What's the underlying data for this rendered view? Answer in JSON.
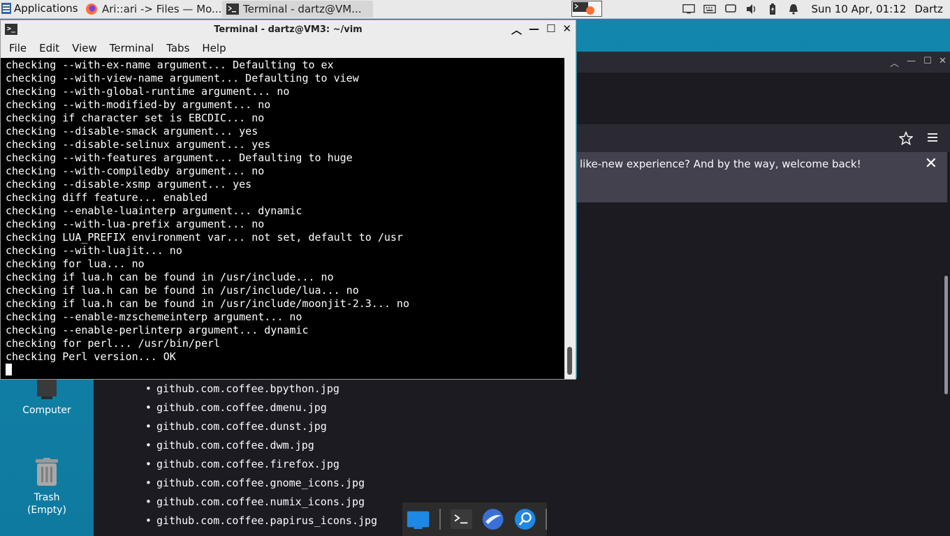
{
  "panel": {
    "apps_label": "Applications",
    "tasks": [
      {
        "label": "Ari::ari -> Files — Mo..."
      },
      {
        "label": "Terminal - dartz@VM..."
      }
    ],
    "clock": "Sun 10 Apr, 01:12",
    "user": "Dartz"
  },
  "desktop": {
    "icons": [
      {
        "label": "Computer"
      },
      {
        "label": "Trash\n(Empty)"
      }
    ]
  },
  "firefox": {
    "notice": "like-new experience? And by the way, welcome back!",
    "files": [
      "github.com.coffee.bpython.jpg",
      "github.com.coffee.dmenu.jpg",
      "github.com.coffee.dunst.jpg",
      "github.com.coffee.dwm.jpg",
      "github.com.coffee.firefox.jpg",
      "github.com.coffee.gnome_icons.jpg",
      "github.com.coffee.numix_icons.jpg",
      "github.com.coffee.papirus_icons.jpg"
    ]
  },
  "terminal": {
    "title": "Terminal - dartz@VM3: ~/vim",
    "menu": [
      "File",
      "Edit",
      "View",
      "Terminal",
      "Tabs",
      "Help"
    ],
    "output": "checking --with-ex-name argument... Defaulting to ex\nchecking --with-view-name argument... Defaulting to view\nchecking --with-global-runtime argument... no\nchecking --with-modified-by argument... no\nchecking if character set is EBCDIC... no\nchecking --disable-smack argument... yes\nchecking --disable-selinux argument... yes\nchecking --with-features argument... Defaulting to huge\nchecking --with-compiledby argument... no\nchecking --disable-xsmp argument... yes\nchecking diff feature... enabled\nchecking --enable-luainterp argument... dynamic\nchecking --with-lua-prefix argument... no\nchecking LUA_PREFIX environment var... not set, default to /usr\nchecking --with-luajit... no\nchecking for lua... no\nchecking if lua.h can be found in /usr/include... no\nchecking if lua.h can be found in /usr/include/lua... no\nchecking if lua.h can be found in /usr/include/moonjit-2.3... no\nchecking --enable-mzschemeinterp argument... no\nchecking --enable-perlinterp argument... dynamic\nchecking for perl... /usr/bin/perl\nchecking Perl version... OK"
  },
  "colors": {
    "desktop": "#1286ad",
    "terminal_bg": "#000000",
    "firefox_bg": "#1c1b22",
    "notice_bg": "#42414d"
  }
}
